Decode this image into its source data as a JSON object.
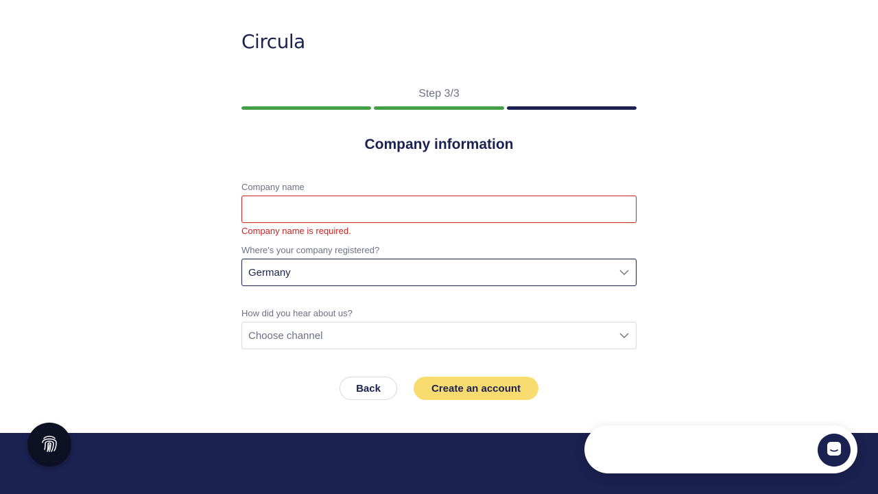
{
  "brand": {
    "logo_text": "Circula"
  },
  "progress": {
    "step_label": "Step 3/3",
    "segments": [
      {
        "state": "complete",
        "color": "#43a047"
      },
      {
        "state": "complete",
        "color": "#43a047"
      },
      {
        "state": "current",
        "color": "#1b2150"
      }
    ]
  },
  "form": {
    "title": "Company information",
    "company_name": {
      "label": "Company name",
      "value": "",
      "error": "Company name is required."
    },
    "country": {
      "label": "Where's your company registered?",
      "value": "Germany"
    },
    "channel": {
      "label": "How did you hear about us?",
      "placeholder": "Choose channel"
    }
  },
  "actions": {
    "back_label": "Back",
    "create_label": "Create an account"
  },
  "colors": {
    "primary": "#1b2150",
    "accent": "#f9dc6f",
    "error": "#d11f1f",
    "success": "#43a047"
  },
  "icons": {
    "fingerprint": "fingerprint-icon",
    "chat": "chat-icon",
    "chevron": "chevron-down-icon"
  }
}
